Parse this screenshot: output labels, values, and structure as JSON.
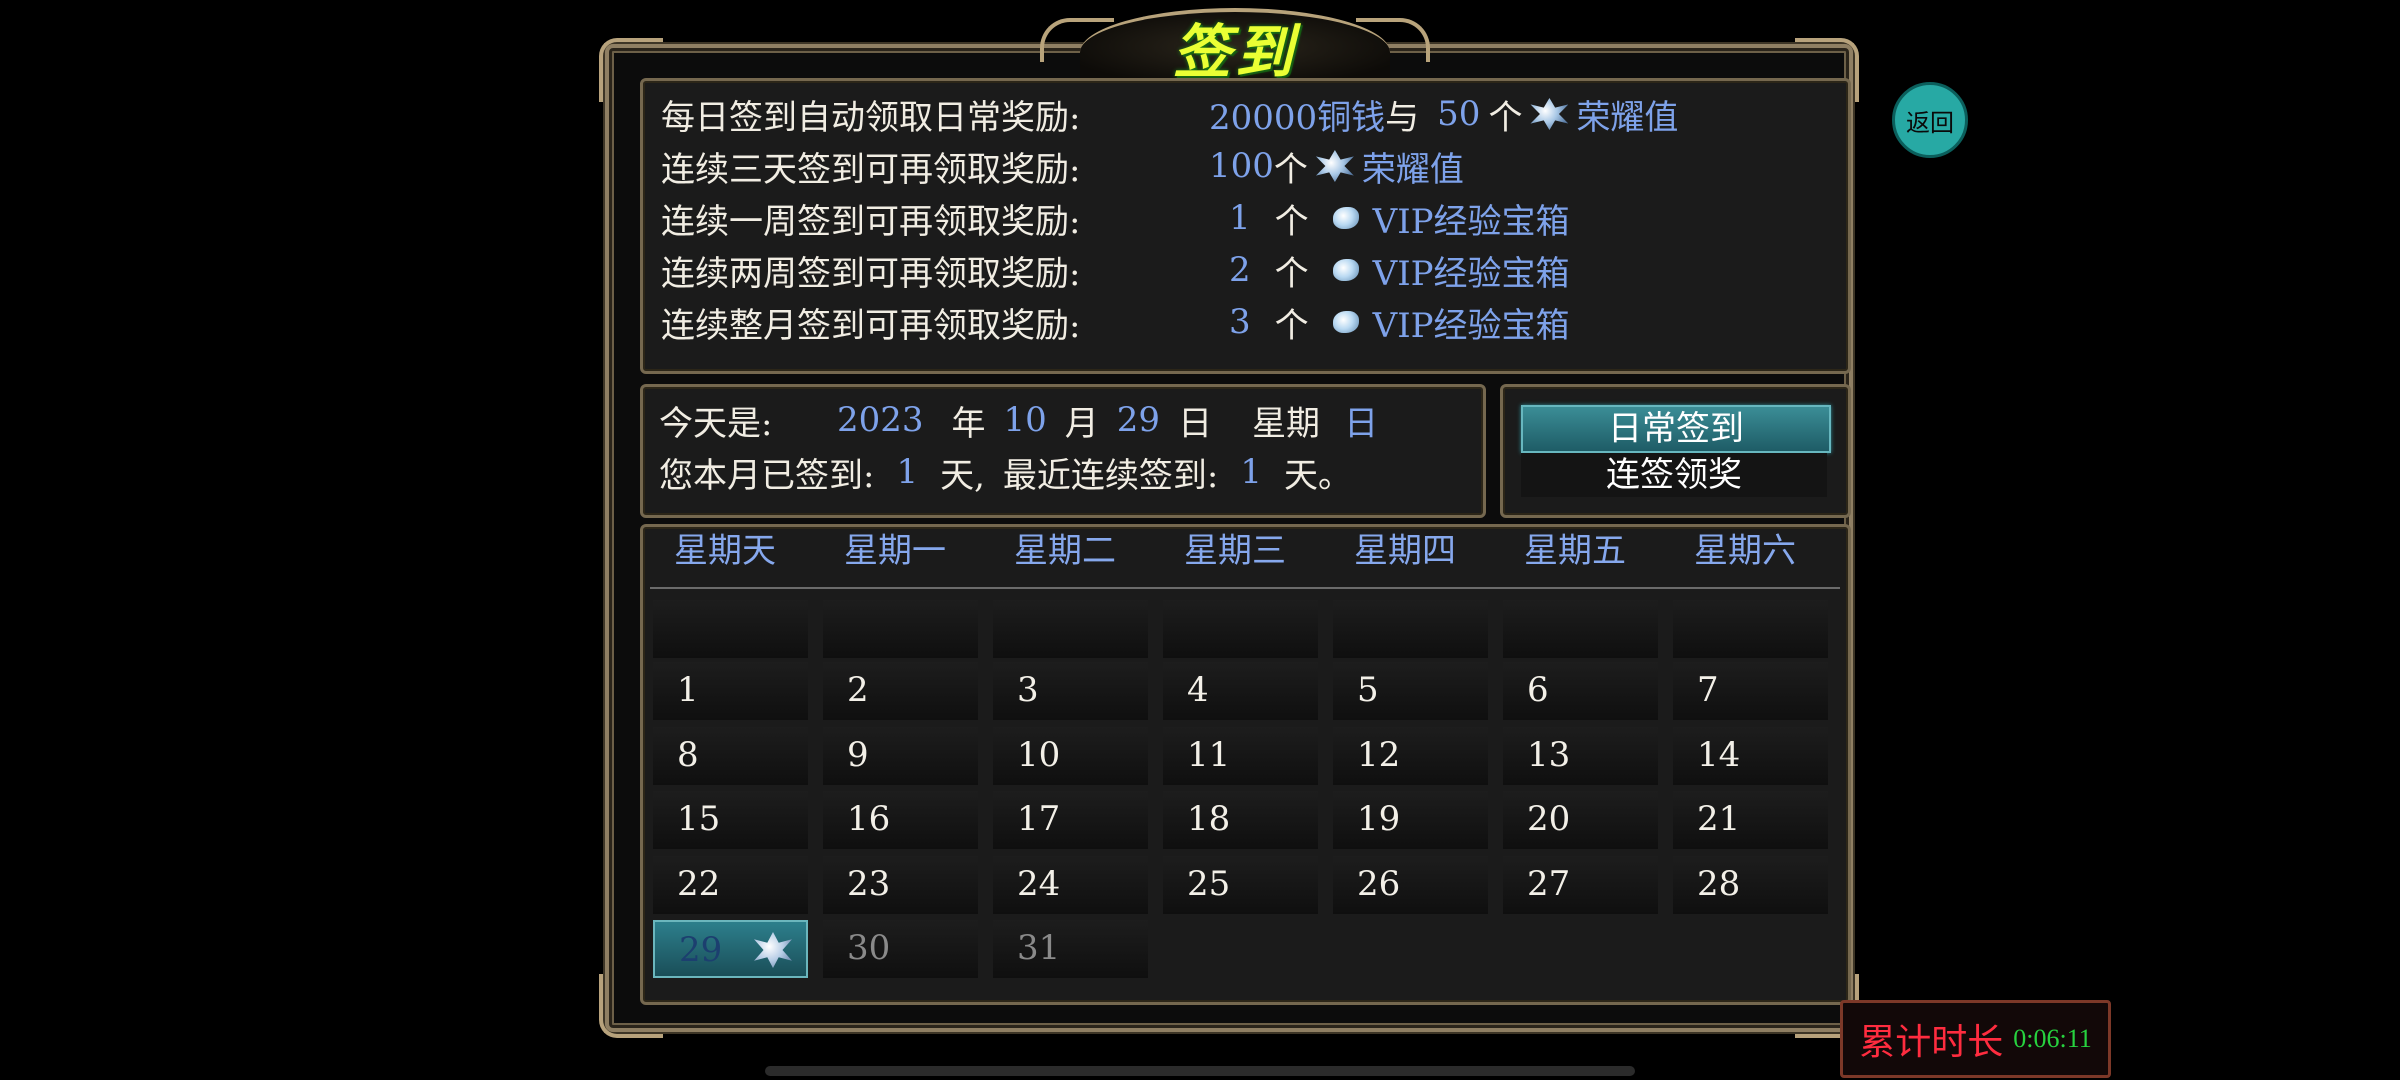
{
  "title": "签到",
  "back_label": "返回",
  "rewards": [
    {
      "label": "每日签到自动领取日常奖励:",
      "amount": "20000铜钱",
      "joiner": "与",
      "count": "50",
      "unit": "个",
      "item": "荣耀值",
      "icon": "honor-gem-icon"
    },
    {
      "label": "连续三天签到可再领取奖励:",
      "amount": "",
      "joiner": "",
      "count": "100",
      "unit": "个",
      "item": "荣耀值",
      "icon": "honor-gem-icon"
    },
    {
      "label": "连续一周签到可再领取奖励:",
      "amount": "",
      "joiner": "",
      "count": "1",
      "unit": "个",
      "item": "VIP经验宝箱",
      "icon": "vip-chest-icon"
    },
    {
      "label": "连续两周签到可再领取奖励:",
      "amount": "",
      "joiner": "",
      "count": "2",
      "unit": "个",
      "item": "VIP经验宝箱",
      "icon": "vip-chest-icon"
    },
    {
      "label": "连续整月签到可再领取奖励:",
      "amount": "",
      "joiner": "",
      "count": "3",
      "unit": "个",
      "item": "VIP经验宝箱",
      "icon": "vip-chest-icon"
    }
  ],
  "today": {
    "prefix": "今天是:",
    "year": "2023",
    "year_unit": "年",
    "month": "10",
    "month_unit": "月",
    "day": "29",
    "day_unit": "日",
    "weekday_prefix": "星期",
    "weekday": "日",
    "signed_prefix": "您本月已签到:",
    "signed_days": "1",
    "signed_unit": "天,",
    "streak_prefix": "最近连续签到:",
    "streak_days": "1",
    "streak_unit": "天。"
  },
  "buttons": {
    "daily_signin": "日常签到",
    "streak_reward": "连签领奖"
  },
  "calendar": {
    "weekdays": [
      "星期天",
      "星期一",
      "星期二",
      "星期三",
      "星期四",
      "星期五",
      "星期六"
    ],
    "weeks": [
      [
        "",
        "",
        "",
        "",
        "",
        "",
        ""
      ],
      [
        "1",
        "2",
        "3",
        "4",
        "5",
        "6",
        "7"
      ],
      [
        "8",
        "9",
        "10",
        "11",
        "12",
        "13",
        "14"
      ],
      [
        "15",
        "16",
        "17",
        "18",
        "19",
        "20",
        "21"
      ],
      [
        "22",
        "23",
        "24",
        "25",
        "26",
        "27",
        "28"
      ],
      [
        "29",
        "30",
        "31",
        "",
        "",
        "",
        ""
      ]
    ],
    "today": "29",
    "signed": [
      "29"
    ],
    "future": [
      "30",
      "31"
    ]
  },
  "timer": {
    "label": "累计时长",
    "value": "0:06:11"
  },
  "colors": {
    "highlight_blue": "#7ea2ea",
    "active_button": "#2d7f8c",
    "title_yellow": "#eaff34",
    "timer_red": "#ff2c3f",
    "timer_green": "#27d23f"
  }
}
